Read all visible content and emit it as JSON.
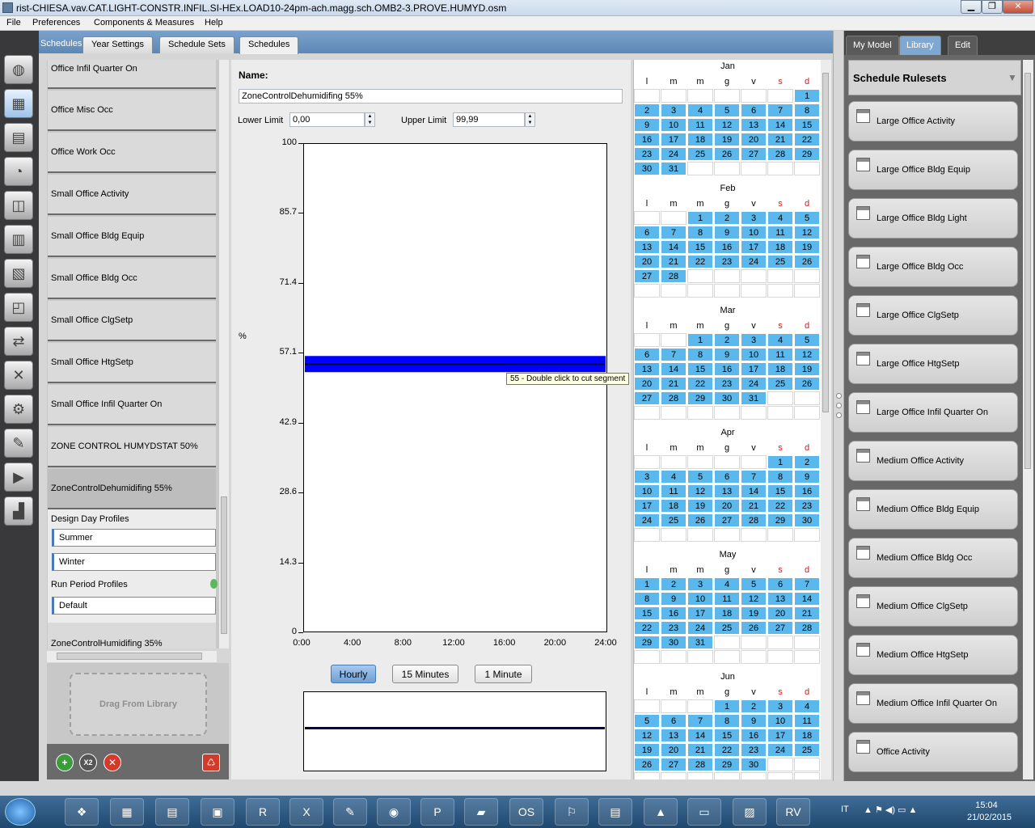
{
  "window": {
    "title": "rist-CHIESA.vav.CAT.LIGHT-CONSTR.INFIL.SI-HEx.LOAD10-24pm-ach.magg.sch.OMB2-3.PROVE.HUMYD.osm"
  },
  "menu": [
    "File",
    "Preferences",
    "Components & Measures",
    "Help"
  ],
  "tabs": {
    "header": "Schedules",
    "year_settings": "Year Settings",
    "schedule_sets": "Schedule Sets",
    "schedules": "Schedules"
  },
  "schedule_list": [
    "Office Infil Quarter On",
    "Office Misc Occ",
    "Office Work Occ",
    "Small Office Activity",
    "Small Office Bldg Equip",
    "Small Office Bldg Occ",
    "Small Office ClgSetp",
    "Small Office HtgSetp",
    "Small Office Infil Quarter On",
    "ZONE CONTROL HUMYDSTAT 50%",
    "ZoneControlDehumidifing 55%"
  ],
  "profiles": {
    "design_day_label": "Design Day Profiles",
    "summer": "Summer",
    "winter": "Winter",
    "run_period_label": "Run Period Profiles",
    "default": "Default",
    "next_item": "ZoneControlHumidifing 35%"
  },
  "drag_from_library": "Drag From Library",
  "editor": {
    "name_label": "Name:",
    "name_value": "ZoneControlDehumidifing 55%",
    "lower_limit_label": "Lower Limit",
    "lower_limit_value": "0,00",
    "upper_limit_label": "Upper Limit",
    "upper_limit_value": "99,99",
    "y_unit": "%",
    "tooltip": "55 - Double click to cut segment",
    "value_percent": 55
  },
  "chart_data": {
    "type": "line",
    "x": [
      "0:00",
      "4:00",
      "8:00",
      "12:00",
      "16:00",
      "20:00",
      "24:00"
    ],
    "y_ticks": [
      "100",
      "85.7",
      "71.4",
      "57.1",
      "42.9",
      "28.6",
      "14.3",
      "0"
    ],
    "ylim": [
      0,
      100
    ],
    "xlabel": "",
    "ylabel": "%",
    "series": [
      {
        "values": [
          55,
          55,
          55,
          55,
          55,
          55,
          55
        ]
      }
    ]
  },
  "resolution_buttons": {
    "hourly": "Hourly",
    "minutes15": "15 Minutes",
    "minute1": "1 Minute"
  },
  "calendar": {
    "weekdays": [
      "l",
      "m",
      "m",
      "g",
      "v",
      "s",
      "d"
    ],
    "months": [
      {
        "name": "Jan",
        "first": 6,
        "days": 31
      },
      {
        "name": "Feb",
        "first": 2,
        "days": 28
      },
      {
        "name": "Mar",
        "first": 2,
        "days": 31
      },
      {
        "name": "Apr",
        "first": 5,
        "days": 30
      },
      {
        "name": "May",
        "first": 0,
        "days": 31
      },
      {
        "name": "Jun",
        "first": 3,
        "days": 30
      }
    ]
  },
  "right_panel": {
    "tabs": [
      "My Model",
      "Library",
      "Edit"
    ],
    "header": "Schedule Rulesets",
    "items": [
      "Large Office Activity",
      "Large Office Bldg Equip",
      "Large Office Bldg Light",
      "Large Office Bldg Occ",
      "Large Office ClgSetp",
      "Large Office HtgSetp",
      "Large Office Infil Quarter On",
      "Medium Office Activity",
      "Medium Office Bldg Equip",
      "Medium Office Bldg Occ",
      "Medium Office ClgSetp",
      "Medium Office HtgSetp",
      "Medium Office Infil Quarter On",
      "Office Activity"
    ]
  },
  "taskbar": {
    "lang": "IT",
    "time": "15:04",
    "date": "21/02/2015"
  }
}
